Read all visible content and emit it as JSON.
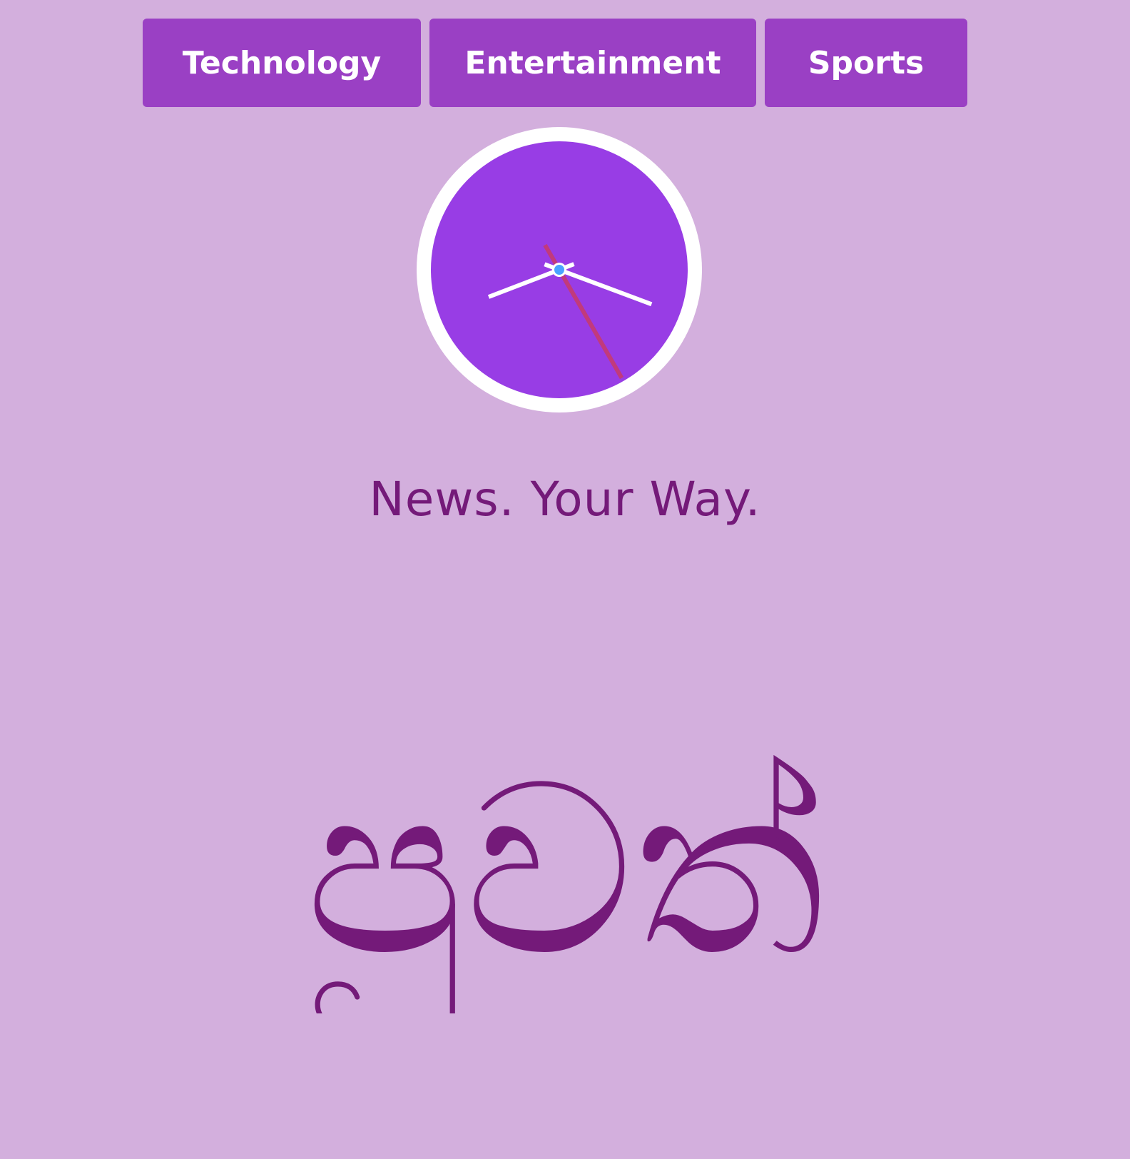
{
  "nav": {
    "technology": "Technology",
    "entertainment": "Entertainment",
    "sports": "Sports"
  },
  "clock": {
    "hour": 8,
    "minute": 18,
    "second": 25,
    "face_color": "#983de5",
    "rim_color": "#ffffff",
    "hand_color": "#ffffff",
    "second_hand_color": "#c13a7c",
    "center_color": "#4aa3ff"
  },
  "tagline": "News. Your Way.",
  "brand": "පුවත්",
  "colors": {
    "background": "#d3afdd",
    "button": "#9a40c4",
    "text_accent": "#741a79"
  }
}
